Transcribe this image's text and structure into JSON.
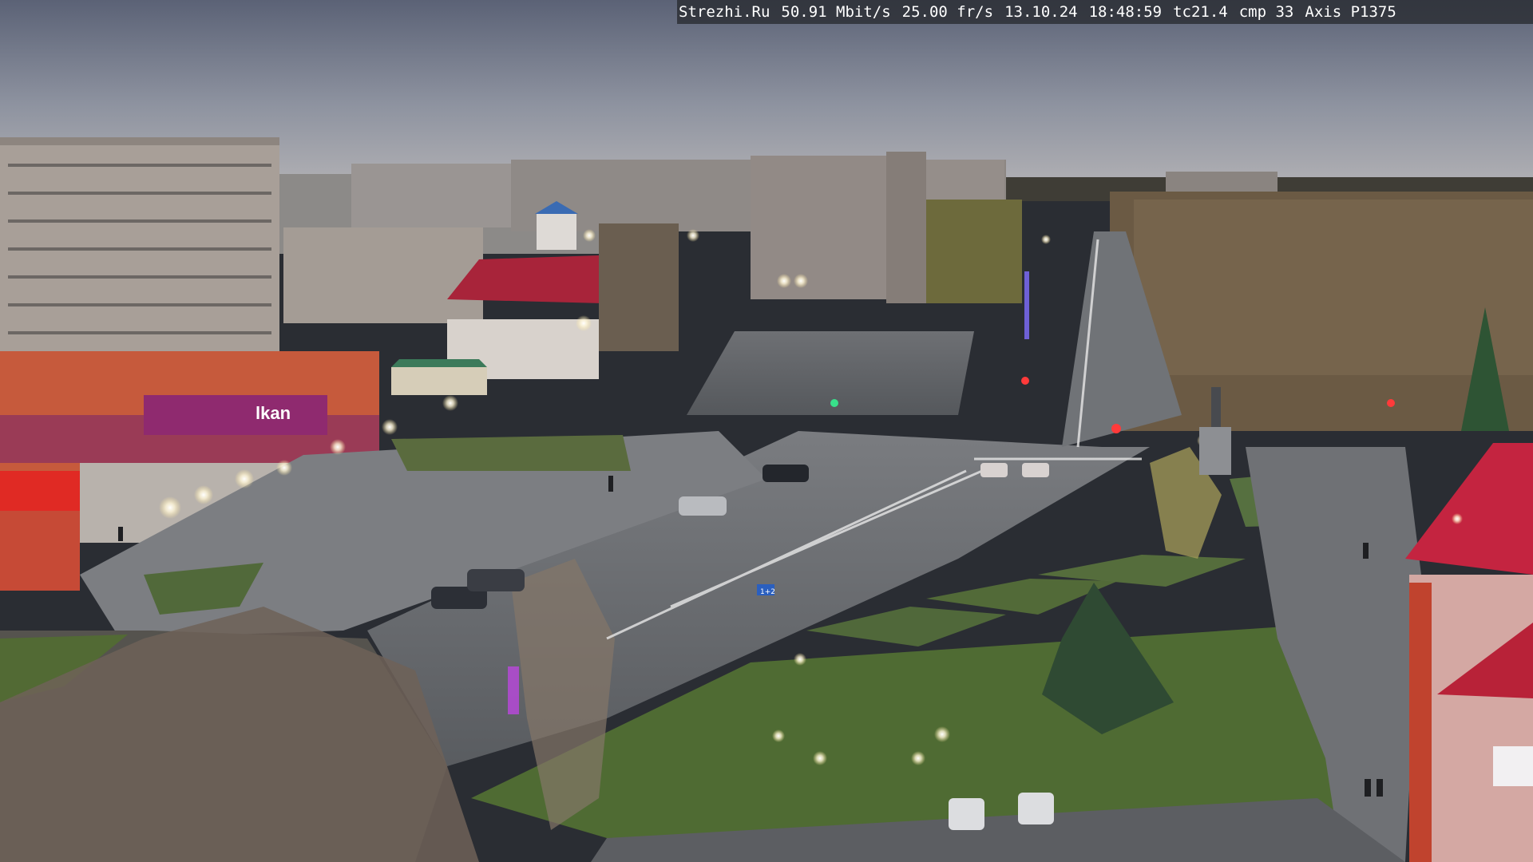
{
  "camera_overlay": {
    "site": "Strezhi.Ru",
    "bitrate": "50.91 Mbit/s",
    "framerate": "25.00 fr/s",
    "date": "13.10.24",
    "time": "18:48:59",
    "tc": "tc21.4",
    "cmp": "cmp 33",
    "camera_model": "Axis P1375"
  },
  "signs": {
    "store_main": "lkan",
    "store_left": "...",
    "road_sign_small": "1+2"
  },
  "colors": {
    "sky_top": "#5d6478",
    "sky_bottom": "#aeb0b8",
    "asphalt": "#5e6166",
    "grass": "#4e6a35",
    "red_roof": "#b8283a",
    "store_facade": "#c75a3c",
    "store_sign": "#8a2a6a"
  }
}
